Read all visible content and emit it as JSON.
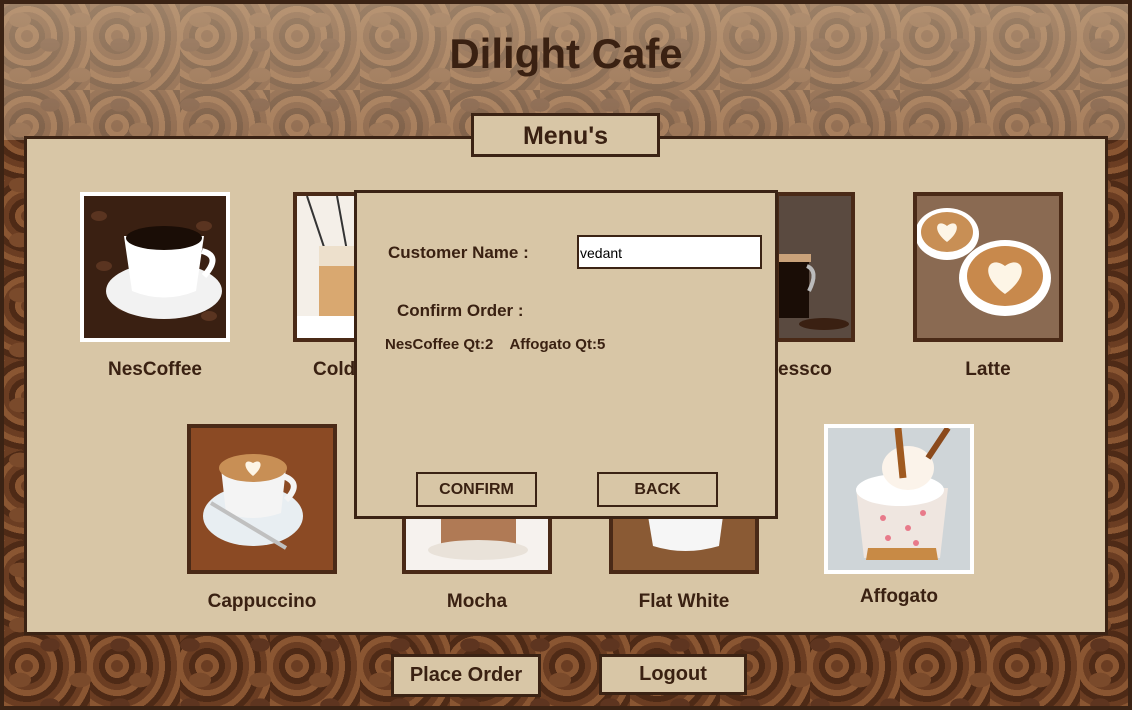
{
  "app": {
    "title": "Dilight Cafe",
    "menu_tab": "Menu's"
  },
  "menu": {
    "items": [
      {
        "label": "NesCoffee",
        "icon": "nescoffee-cup-photo"
      },
      {
        "label": "Cold",
        "icon": "cold-coffee-photo"
      },
      {
        "label": "essco",
        "icon": "espresso-photo"
      },
      {
        "label": "Latte",
        "icon": "latte-photo"
      },
      {
        "label": "Cappuccino",
        "icon": "cappuccino-photo"
      },
      {
        "label": "Mocha",
        "icon": "mocha-photo"
      },
      {
        "label": "Flat White",
        "icon": "flat-white-photo"
      },
      {
        "label": "Affogato",
        "icon": "affogato-photo"
      }
    ]
  },
  "dialog": {
    "customer_name_label": "Customer Name :",
    "customer_name_value": "vedant",
    "confirm_order_label": "Confirm Order :",
    "order_summary": "NesCoffee Qt:2    Affogato Qt:5",
    "confirm_button": "CONFIRM",
    "back_button": "BACK"
  },
  "footer": {
    "place_order_button": "Place Order",
    "logout_button": "Logout"
  },
  "colors": {
    "panel": "#d8c6a6",
    "border": "#3b2314",
    "text": "#3a2112"
  }
}
